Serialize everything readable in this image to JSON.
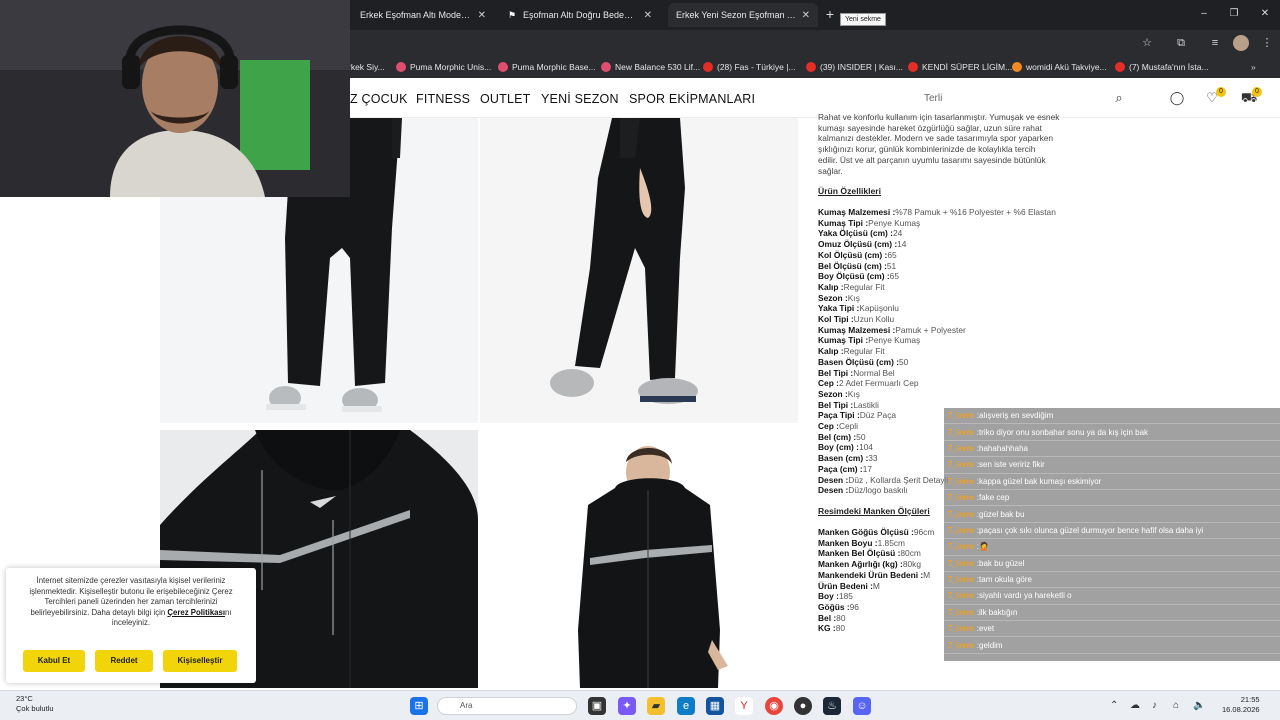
{
  "browser": {
    "tabs": [
      {
        "title": "Erkek Eşofman Altı Modelleri | G",
        "active": false
      },
      {
        "title": "Eşofman Altı Doğru Beden Seçim",
        "active": false
      },
      {
        "title": "Erkek Yeni Sezon Eşofman Altı",
        "active": true
      }
    ],
    "newtab_tooltip": "Yeni sekme",
    "bookmarks": [
      {
        "label": "rkek Siy...",
        "color": "#888"
      },
      {
        "label": "Puma Morphic Unis...",
        "color": "#e04e6e"
      },
      {
        "label": "Puma Morphic Base...",
        "color": "#e04e6e"
      },
      {
        "label": "New Balance 530 Lif...",
        "color": "#e04e6e"
      },
      {
        "label": "(28) Fas - Türkiye |...",
        "color": "#e52d27"
      },
      {
        "label": "(39) INSIDER | Kası...",
        "color": "#e52d27"
      },
      {
        "label": "KENDİ SÜPER LİGİM...",
        "color": "#e52d27"
      },
      {
        "label": "womidi Akü Takviye...",
        "color": "#f08a24"
      },
      {
        "label": "(7) Mustafa'nın İsta...",
        "color": "#e52d27"
      }
    ]
  },
  "site": {
    "nav": [
      "Z ÇOCUK",
      "FITNESS",
      "OUTLET",
      "YENİ SEZON",
      "SPOR EKİPMANLARI"
    ],
    "search_placeholder": "Terli",
    "fav_count": "0",
    "cart_count": "0"
  },
  "product": {
    "description_lines": [
      "Rahat ve konforlu kullanım için tasarlanmıştır. Yumuşak ve esnek",
      "kumaşı sayesinde hareket özgürlüğü sağlar, uzun süre rahat",
      "kalmanızı destekler. Modern ve sade tasarımıyla spor yaparken",
      "şıklığınızı korur, günlük kombinlerinizde de kolaylıkla tercih",
      "edilir. Üst ve alt parçanın uyumlu tasarımı sayesinde bütünlük",
      "sağlar."
    ],
    "features_title": "Ürün Özellikleri",
    "features": [
      {
        "k": "Kumaş Malzemesi :",
        "v": "%78 Pamuk + %16 Polyester + %6 Elastan"
      },
      {
        "k": "Kumaş Tipi :",
        "v": "Penye Kumaş"
      },
      {
        "k": "Yaka Ölçüsü (cm) :",
        "v": "24"
      },
      {
        "k": "Omuz Ölçüsü (cm) :",
        "v": "14"
      },
      {
        "k": "Kol Ölçüsü (cm) :",
        "v": "65"
      },
      {
        "k": "Bel Ölçüsü (cm) :",
        "v": "51"
      },
      {
        "k": "Boy Ölçüsü (cm) :",
        "v": "65"
      },
      {
        "k": "Kalıp :",
        "v": "Regular Fit"
      },
      {
        "k": "Sezon :",
        "v": "Kış"
      },
      {
        "k": "Yaka Tipi :",
        "v": "Kapüşonlu"
      },
      {
        "k": "Kol Tipi :",
        "v": "Uzun Kollu"
      },
      {
        "k": "Kumaş Malzemesi :",
        "v": "Pamuk + Polyester"
      },
      {
        "k": "Kumaş Tipi :",
        "v": "Penye Kumaş"
      },
      {
        "k": "Kalıp :",
        "v": "Regular Fit"
      },
      {
        "k": "Basen Ölçüsü (cm) :",
        "v": "50"
      },
      {
        "k": "Bel Tipi :",
        "v": "Normal Bel"
      },
      {
        "k": "Cep :",
        "v": "2 Adet Fermuarlı Cep"
      },
      {
        "k": "Sezon :",
        "v": "Kış"
      },
      {
        "k": "Bel Tipi :",
        "v": "Lastikli"
      },
      {
        "k": "Paça Tipi :",
        "v": "Düz Paça"
      },
      {
        "k": "Cep :",
        "v": "Cepli"
      },
      {
        "k": "Bel (cm) :",
        "v": "50"
      },
      {
        "k": "Boy (cm) :",
        "v": "104"
      },
      {
        "k": "Basen (cm) :",
        "v": "33"
      },
      {
        "k": "Paça (cm) :",
        "v": "17"
      },
      {
        "k": "Desen :",
        "v": "Düz , Kollarda Şerit Detaylı"
      },
      {
        "k": "Desen :",
        "v": "Düz/logo baskılı"
      }
    ],
    "model_title": "Resimdeki Manken Ölçüleri",
    "model": [
      {
        "k": "Manken Göğüs Ölçüsü :",
        "v": "96cm"
      },
      {
        "k": "Manken Boyu :",
        "v": "1.85cm"
      },
      {
        "k": "Manken Bel Ölçüsü :",
        "v": "80cm"
      },
      {
        "k": "Manken Ağırlığı (kg) :",
        "v": "80kg"
      },
      {
        "k": "Mankendeki Ürün Bedeni :",
        "v": "M"
      },
      {
        "k": "Ürün Bedeni :",
        "v": "M"
      },
      {
        "k": "Boy :",
        "v": "185"
      },
      {
        "k": "Göğüs :",
        "v": "96"
      },
      {
        "k": "Bel :",
        "v": "80"
      },
      {
        "k": "KG :",
        "v": "80"
      }
    ]
  },
  "chat": [
    {
      "user": "7_irem",
      "text": "alışveriş en sevdiğim"
    },
    {
      "user": "7_irem",
      "text": "triko diyor onu sonbahar sonu ya da kış için bak"
    },
    {
      "user": "7_irem",
      "text": "hahahahhaha"
    },
    {
      "user": "7_irem",
      "text": "sen iste veririz fikir"
    },
    {
      "user": "7_irem",
      "text": "kappa güzel bak kumaşı eskimiyor"
    },
    {
      "user": "7_irem",
      "text": "fake cep"
    },
    {
      "user": "7_irem",
      "text": "güzel bak bu"
    },
    {
      "user": "7_irem",
      "text": "paçası çok sıkı olunca güzel durmuyor bence hafif olsa daha iyi"
    },
    {
      "user": "7_irem",
      "text": "🤦"
    },
    {
      "user": "7_irem",
      "text": "bak bu güzel"
    },
    {
      "user": "7_irem",
      "text": "tam okula göre"
    },
    {
      "user": "7_irem",
      "text": "siyahlı vardı ya hareketli o"
    },
    {
      "user": "7_irem",
      "text": "ilk baktığın"
    },
    {
      "user": "7_irem",
      "text": "evet"
    },
    {
      "user": "7_irem",
      "text": "geldim"
    }
  ],
  "cookie": {
    "text_before": "İnternet sitemizde çerezler vasıtasıyla kişisel verileriniz işlenmektedir. Kişiselleştir butonu ile erişebileceğiniz Çerez Tercihleri paneli üzerinden her zaman tercihlerinizi belirleyebilirsiniz. Daha detaylı bilgi için ",
    "link": "Çerez Politikası",
    "text_after": "nı inceleyiniz.",
    "accept": "Kabul Et",
    "reject": "Reddet",
    "customize": "Kişiselleştir"
  },
  "taskbar": {
    "temp": "23°C",
    "weather": "Çok bulutlu",
    "search": "Ara",
    "time": "21:55",
    "date": "16.08.2026"
  }
}
